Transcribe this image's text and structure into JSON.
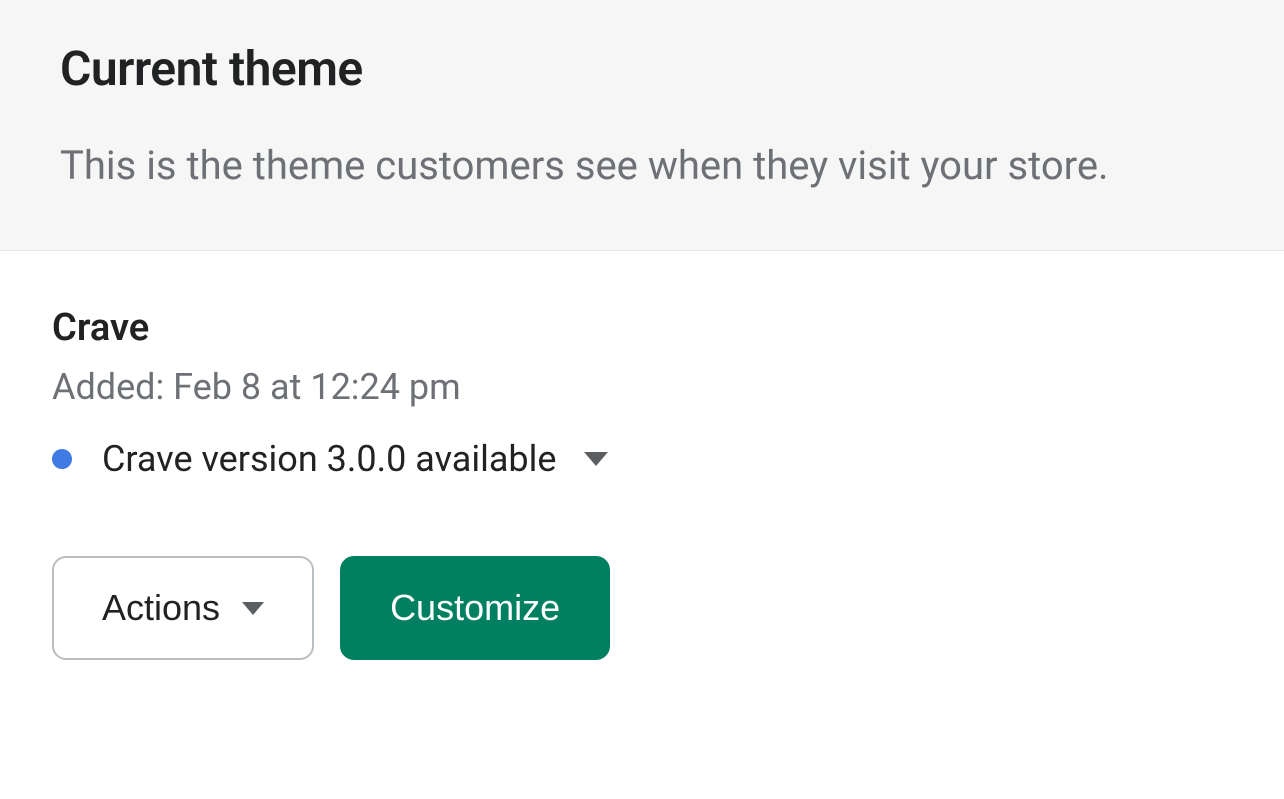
{
  "header": {
    "title": "Current theme",
    "subtitle": "This is the theme customers see when they visit your store."
  },
  "theme": {
    "name": "Crave",
    "added_text": "Added: Feb 8 at 12:24 pm",
    "version_text": "Crave version 3.0.0 available",
    "status_color": "#3f7ae5"
  },
  "buttons": {
    "actions_label": "Actions",
    "customize_label": "Customize"
  }
}
